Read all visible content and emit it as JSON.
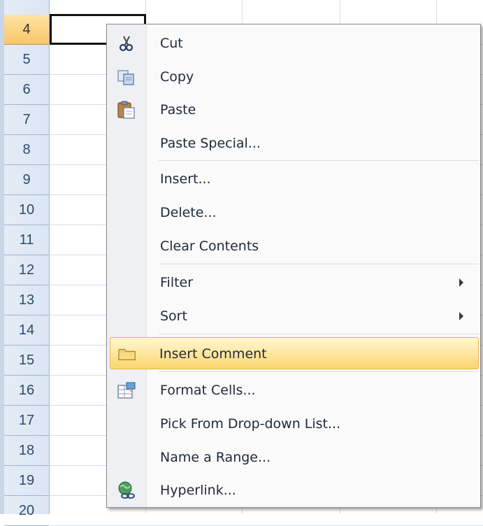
{
  "sheet": {
    "row_numbers": [
      "4",
      "5",
      "6",
      "7",
      "8",
      "9",
      "10",
      "11",
      "12",
      "13",
      "14",
      "15",
      "16",
      "17",
      "18",
      "19",
      "20"
    ],
    "active_row": "4"
  },
  "context_menu": {
    "items": [
      {
        "label": "Cut",
        "icon": "scissors-icon"
      },
      {
        "label": "Copy",
        "icon": "copy-icon"
      },
      {
        "label": "Paste",
        "icon": "clipboard-paste-icon"
      },
      {
        "label": "Paste Special...",
        "icon": ""
      },
      {
        "label": "Insert...",
        "icon": ""
      },
      {
        "label": "Delete...",
        "icon": ""
      },
      {
        "label": "Clear Contents",
        "icon": ""
      },
      {
        "label": "Filter",
        "icon": "",
        "submenu": true
      },
      {
        "label": "Sort",
        "icon": "",
        "submenu": true
      },
      {
        "label": "Insert Comment",
        "icon": "comment-folder-icon",
        "highlighted": true
      },
      {
        "label": "Format Cells...",
        "icon": "format-cells-icon"
      },
      {
        "label": "Pick From Drop-down List...",
        "icon": ""
      },
      {
        "label": "Name a Range...",
        "icon": ""
      },
      {
        "label": "Hyperlink...",
        "icon": "hyperlink-globe-icon"
      }
    ]
  },
  "colors": {
    "highlight": "#fcd46e",
    "row_header_active": "#f9c66b",
    "menu_gutter": "#eef0f3"
  }
}
